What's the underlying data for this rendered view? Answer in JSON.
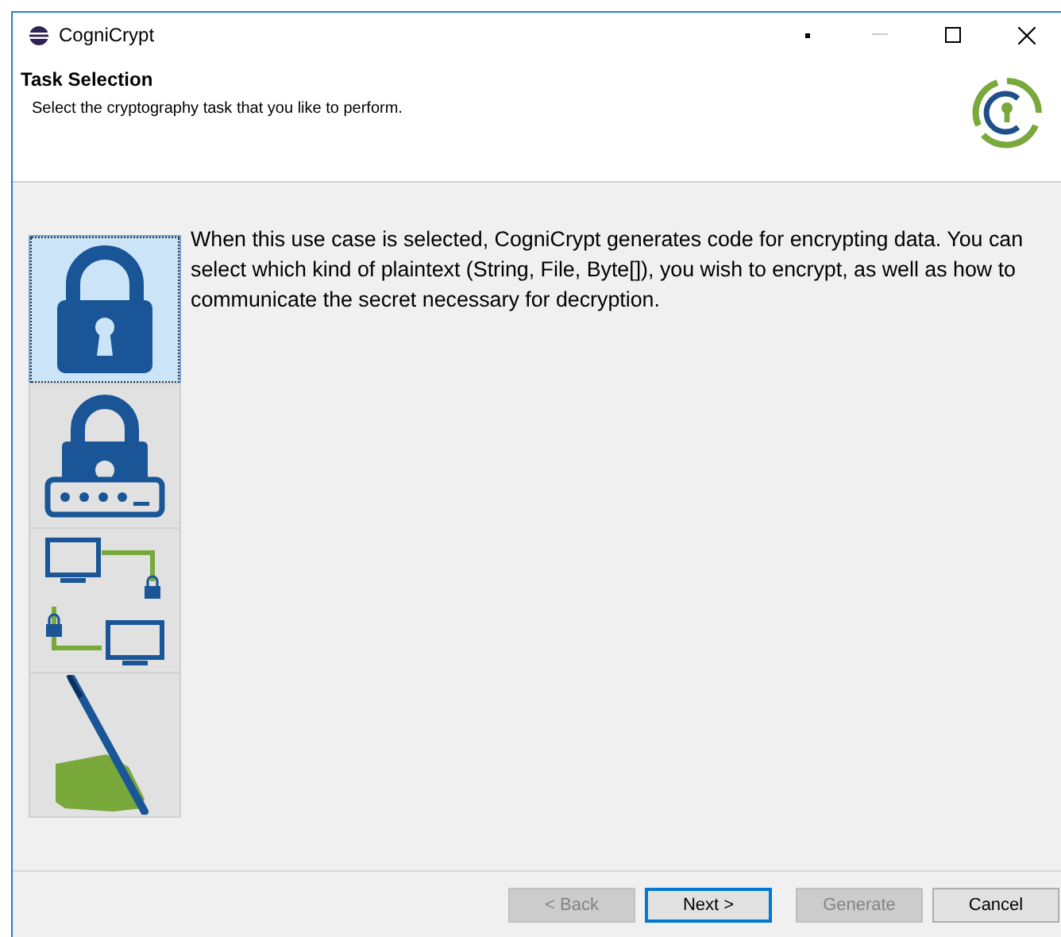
{
  "window": {
    "title": "CogniCrypt"
  },
  "header": {
    "title": "Task Selection",
    "description": "Select the cryptography task that you like to perform."
  },
  "tasks": [
    {
      "kind": "lock",
      "selected": true
    },
    {
      "kind": "password",
      "selected": false
    },
    {
      "kind": "network",
      "selected": false
    },
    {
      "kind": "sign",
      "selected": false
    }
  ],
  "task_description": "When this use case is selected, CogniCrypt generates code for encrypting data. You can select which kind of plaintext (String, File, Byte[]), you wish to encrypt, as well as how to communicate the secret necessary for decryption.",
  "buttons": [
    {
      "label": "< Back",
      "disabled": true,
      "default": false
    },
    {
      "label": "Next >",
      "disabled": false,
      "default": true
    },
    {
      "label": "Generate",
      "disabled": true,
      "default": false
    },
    {
      "label": "Cancel",
      "disabled": false,
      "default": false
    }
  ]
}
